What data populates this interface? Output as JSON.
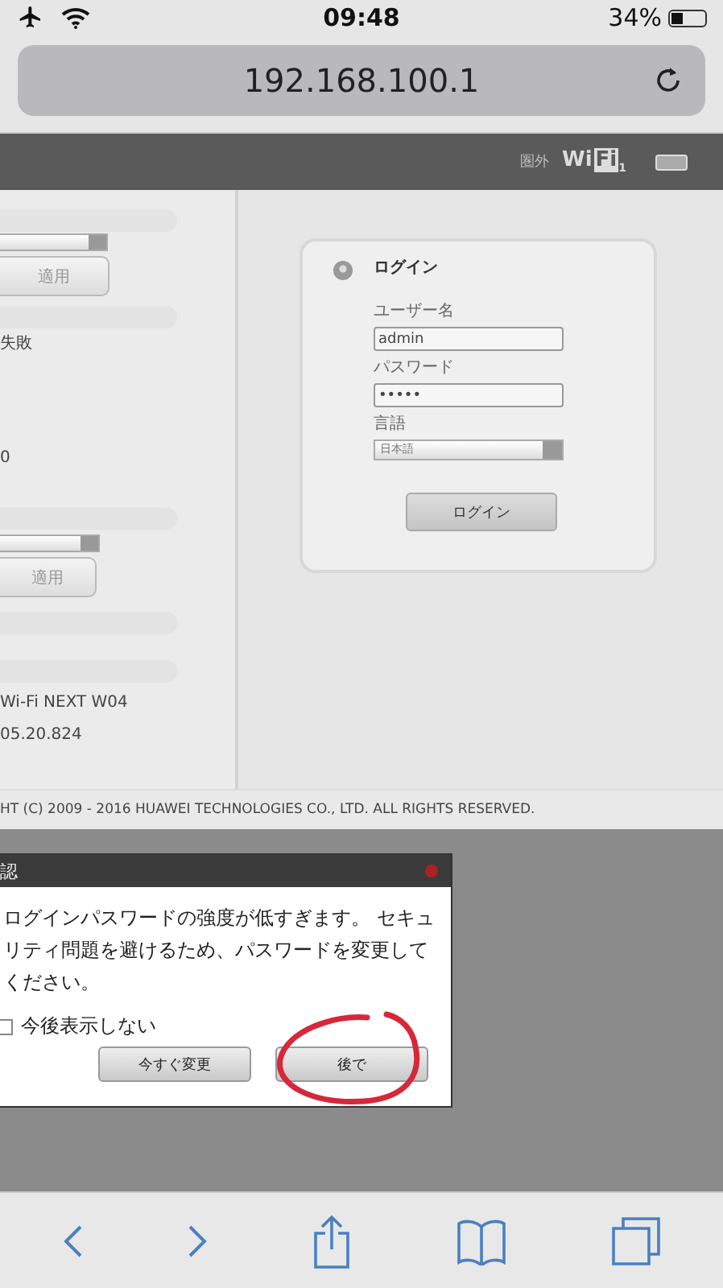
{
  "status_bar": {
    "time": "09:48",
    "battery": {
      "text": "34%",
      "level": 0.34
    }
  },
  "address_bar": {
    "url": "192.168.100.1"
  },
  "router_header": {
    "signal": "圏外",
    "wifi_logo": {
      "text": "Wi",
      "boxed": "Fi",
      "index": "1"
    }
  },
  "side_panel": {
    "items": [
      {
        "kind": "select"
      },
      {
        "kind": "button",
        "label": "適用"
      },
      {
        "kind": "text",
        "label": "失敗"
      },
      {
        "kind": "text",
        "label": "0"
      },
      {
        "kind": "select"
      },
      {
        "kind": "button",
        "label": "適用"
      },
      {
        "kind": "text",
        "label": "Wi-Fi NEXT W04"
      },
      {
        "kind": "text",
        "label": "05.20.824"
      }
    ]
  },
  "login": {
    "title": "ログイン",
    "username_label": "ユーザー名",
    "username": "admin",
    "password_label": "パスワード",
    "password": "•••••",
    "language_label": "言語",
    "language": "日本語",
    "button": "ログイン"
  },
  "footer": {
    "text": "HT (C) 2009 - 2016 HUAWEI TECHNOLOGIES CO., LTD. ALL RIGHTS RESERVED."
  },
  "dialog": {
    "title": "認",
    "message": "ログインパスワードの強度が低すぎます。 セキュリティ問題を避けるため、パスワードを変更してください。",
    "checkbox": {
      "label": "今後表示しない",
      "checked": false
    },
    "buttons": [
      "今すぐ変更",
      "後で"
    ]
  }
}
